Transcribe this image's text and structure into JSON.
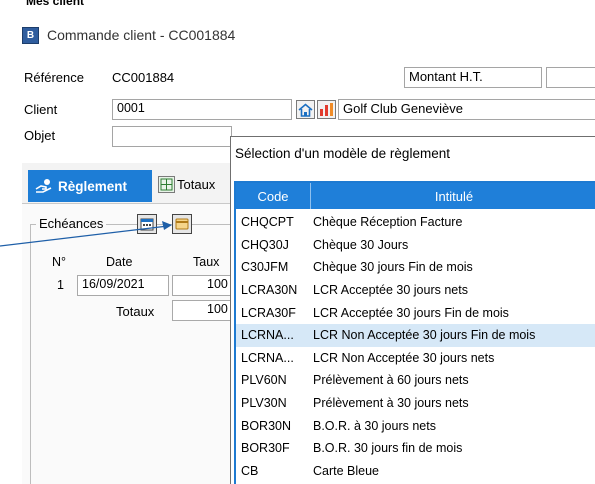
{
  "top_cut_label": "Mes client",
  "window": {
    "title": "Commande client - CC001884",
    "app_icon_letter": "B"
  },
  "form": {
    "reference_label": "Référence",
    "reference_value": "CC001884",
    "montant_label": "Montant H.T.",
    "client_label": "Client",
    "client_value": "0001",
    "client_name": "Golf Club Geneviève",
    "objet_label": "Objet",
    "objet_value": ""
  },
  "tabs": [
    {
      "label": "Règlement",
      "active": true
    },
    {
      "label": "Totaux",
      "active": false
    }
  ],
  "echeances": {
    "group_label": "Echéances",
    "columns": [
      "N°",
      "Date",
      "Taux"
    ],
    "rows": [
      {
        "num": "1",
        "date": "16/09/2021",
        "taux": "100"
      }
    ],
    "totals_label": "Totaux",
    "totals_value": "100"
  },
  "popup": {
    "title": "Sélection d'un modèle de règlement",
    "columns": {
      "code": "Code",
      "intitule": "Intitulé"
    },
    "selected_index": 5,
    "rows": [
      {
        "code": "CHQCPT",
        "intitule": "Chèque Réception Facture"
      },
      {
        "code": "CHQ30J",
        "intitule": "Chèque 30 Jours"
      },
      {
        "code": "C30JFM",
        "intitule": "Chèque 30 jours Fin de  mois"
      },
      {
        "code": "LCRA30N",
        "intitule": "LCR Acceptée 30 jours nets"
      },
      {
        "code": "LCRA30F",
        "intitule": "LCR Acceptée 30 jours Fin de mois"
      },
      {
        "code": "LCRNA...",
        "intitule": "LCR Non Acceptée 30 jours Fin de mois"
      },
      {
        "code": "LCRNA...",
        "intitule": "LCR Non Acceptée 30 jours nets"
      },
      {
        "code": "PLV60N",
        "intitule": "Prélèvement à 60 jours nets"
      },
      {
        "code": "PLV30N",
        "intitule": "Prélèvement à 30 jours nets"
      },
      {
        "code": "BOR30N",
        "intitule": "B.O.R. à 30 jours nets"
      },
      {
        "code": "BOR30F",
        "intitule": "B.O.R. 30 jours fin de mois"
      },
      {
        "code": "CB",
        "intitule": "Carte Bleue"
      }
    ]
  },
  "colors": {
    "accent": "#1f7fd9",
    "selected_row": "#d6e8f7",
    "tab_active": "#1d7dd6"
  }
}
